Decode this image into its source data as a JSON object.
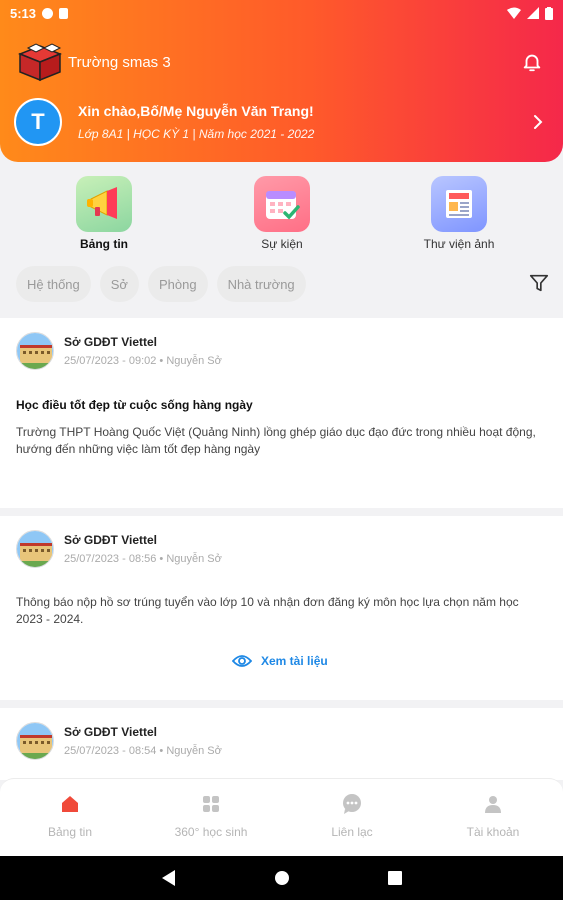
{
  "status_bar": {
    "time": "5:13"
  },
  "header": {
    "school_name": "Trường smas 3",
    "avatar_letter": "T",
    "greeting": "Xin chào,Bố/Mẹ Nguyễn Văn Trang!",
    "class_info": "Lớp 8A1 | HỌC KỲ 1 | Năm học 2021 - 2022"
  },
  "quick_menu": {
    "items": [
      {
        "label": "Bảng tin",
        "icon": "megaphone-icon"
      },
      {
        "label": "Sự kiện",
        "icon": "calendar-icon"
      },
      {
        "label": "Thư viện ảnh",
        "icon": "news-gallery-icon"
      }
    ]
  },
  "filters": {
    "chips": [
      "Hệ thống",
      "Sở",
      "Phòng",
      "Nhà trường"
    ],
    "icon": "filter-icon"
  },
  "feed": {
    "posts": [
      {
        "source": "Sở GDĐT Viettel",
        "time": "25/07/2023 - 09:02 • Nguyễn Sở",
        "title": "Học điều tốt đẹp từ cuộc sống hàng ngày",
        "body": "Trường THPT Hoàng Quốc Việt (Quảng Ninh) lồng ghép giáo dục đạo đức trong nhiều hoạt động, hướng đến những việc làm tốt đẹp hàng ngày"
      },
      {
        "source": "Sở GDĐT Viettel",
        "time": "25/07/2023 - 08:56 • Nguyễn Sở",
        "body": "Thông báo nộp hồ sơ trúng tuyển vào lớp 10 và nhận đơn đăng ký môn học lựa chọn năm học 2023 - 2024.",
        "link_label": "Xem tài liệu"
      },
      {
        "source": "Sở GDĐT Viettel",
        "time": "25/07/2023 - 08:54 • Nguyễn Sở"
      }
    ]
  },
  "bottom_nav": {
    "items": [
      {
        "label": "Bảng tin",
        "icon": "home-icon"
      },
      {
        "label": "360° học sinh",
        "icon": "grid-icon"
      },
      {
        "label": "Liên lạc",
        "icon": "chat-icon"
      },
      {
        "label": "Tài khoản",
        "icon": "person-icon"
      }
    ]
  },
  "colors": {
    "accent": "#ff5a2a",
    "header_start": "#ff8a1a",
    "header_end": "#f5284a",
    "link": "#1e88e5"
  }
}
